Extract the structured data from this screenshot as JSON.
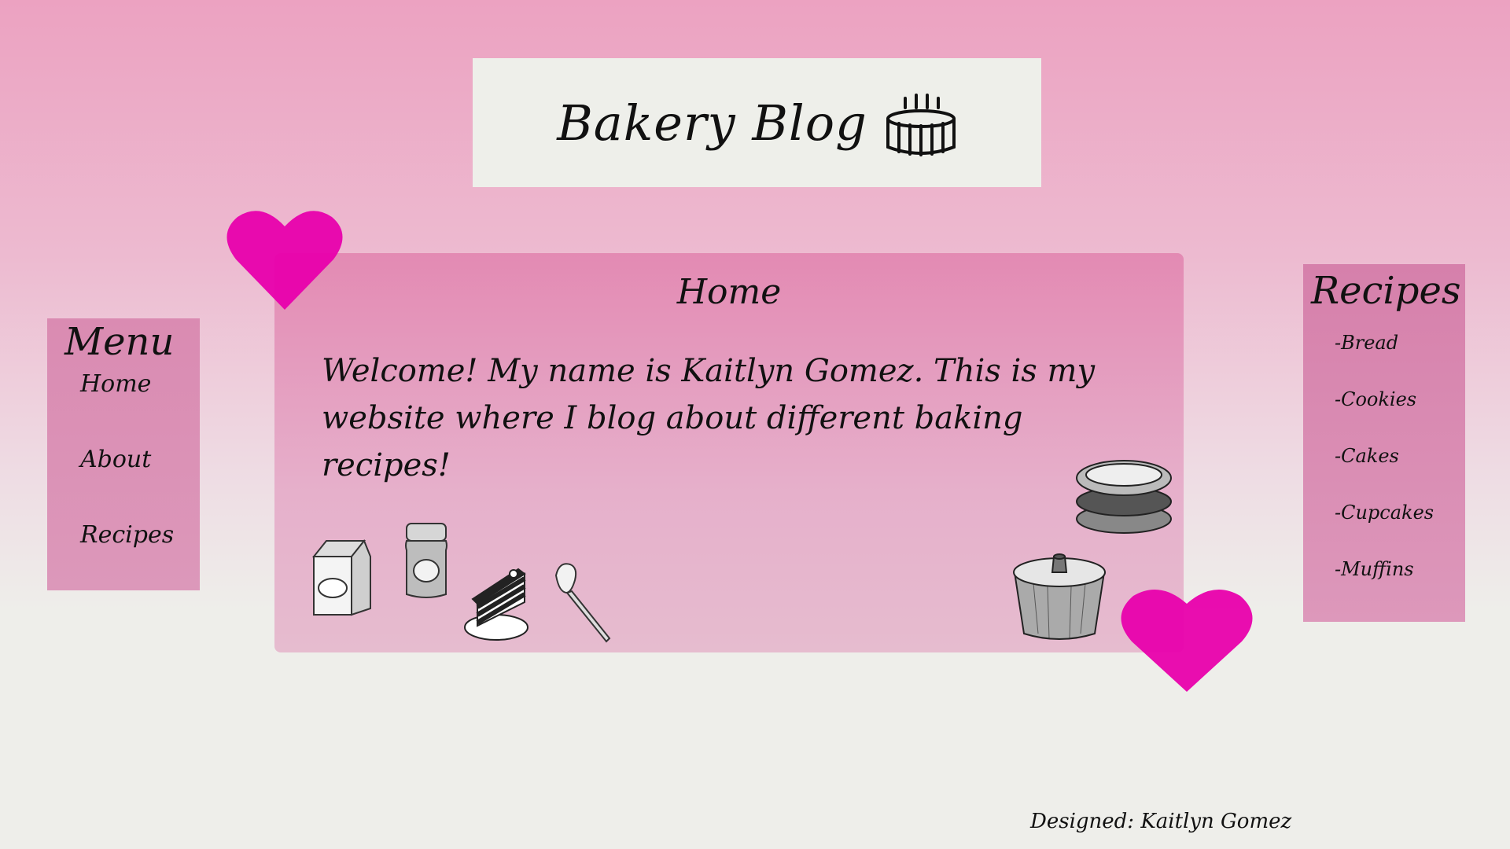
{
  "header": {
    "title": "Bakery Blog",
    "icon": "birthday-cake-icon"
  },
  "menu": {
    "title": "Menu",
    "items": [
      {
        "label": "Home"
      },
      {
        "label": "About"
      },
      {
        "label": "Recipes"
      }
    ]
  },
  "main": {
    "heading": "Home",
    "welcome": "Welcome! My name is Kaitlyn Gomez. This is my website where I blog about different baking recipes!",
    "illustrations": [
      "milk-carton-icon",
      "jam-jar-icon",
      "cake-slice-icon",
      "spatula-icon",
      "tart-pans-icon",
      "bundt-pan-icon"
    ]
  },
  "recipes": {
    "title": "Recipes",
    "items": [
      {
        "label": "-Bread"
      },
      {
        "label": "-Cookies"
      },
      {
        "label": "-Cakes"
      },
      {
        "label": "-Cupcakes"
      },
      {
        "label": "-Muffins"
      }
    ]
  },
  "footer": {
    "credit": "Designed: Kaitlyn Gomez"
  },
  "colors": {
    "heart": "#e800ac",
    "title_box": "#eeefea",
    "panel_pink": "#e38ab3",
    "sidebar_pink": "#da8bb2"
  }
}
